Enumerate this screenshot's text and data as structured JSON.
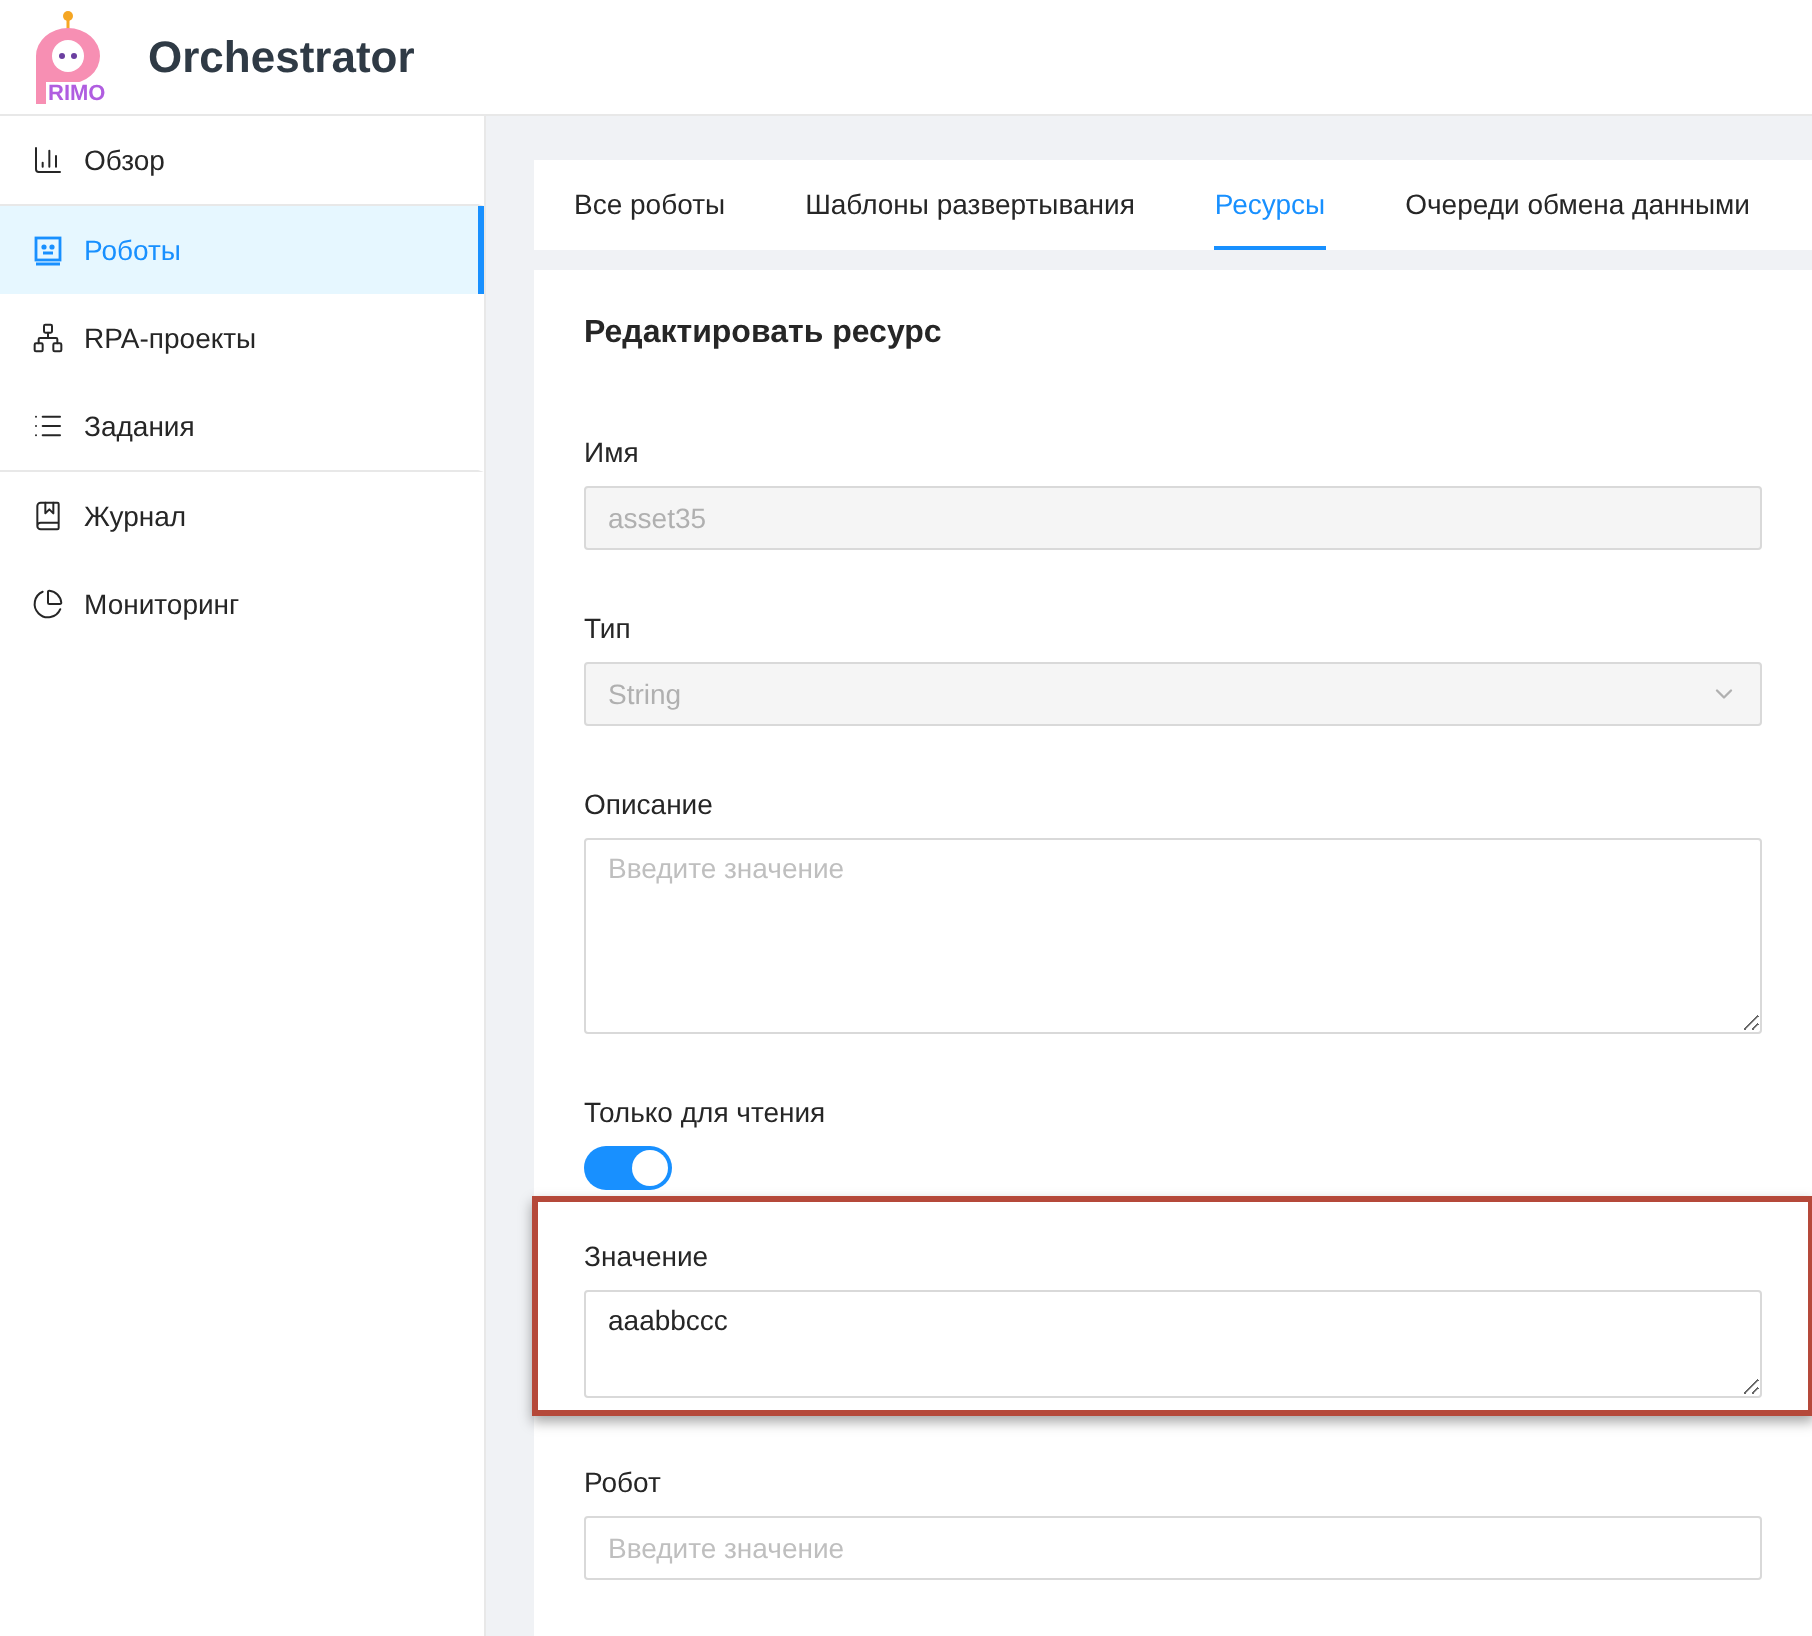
{
  "header": {
    "logo_text": "RIMO",
    "title": "Orchestrator"
  },
  "sidebar": {
    "items": [
      {
        "label": "Обзор",
        "selected": false,
        "divider_after": true
      },
      {
        "label": "Роботы",
        "selected": true,
        "divider_after": false
      },
      {
        "label": "RPA-проекты",
        "selected": false,
        "divider_after": false
      },
      {
        "label": "Задания",
        "selected": false,
        "divider_after": true
      },
      {
        "label": "Журнал",
        "selected": false,
        "divider_after": false
      },
      {
        "label": "Мониторинг",
        "selected": false,
        "divider_after": false
      }
    ]
  },
  "tabs": [
    {
      "label": "Все роботы",
      "selected": false
    },
    {
      "label": "Шаблоны развертывания",
      "selected": false
    },
    {
      "label": "Ресурсы",
      "selected": true
    },
    {
      "label": "Очереди обмена данными",
      "selected": false
    }
  ],
  "form": {
    "title": "Редактировать ресурс",
    "fields": [
      {
        "kind": "input",
        "label": "Имя",
        "value": "asset35",
        "disabled": true,
        "highlighted": false
      },
      {
        "kind": "select",
        "label": "Тип",
        "value": "String",
        "disabled": true,
        "highlighted": false
      },
      {
        "kind": "textarea",
        "label": "Описание",
        "placeholder": "Введите значение",
        "highlighted": false
      },
      {
        "kind": "switch",
        "label": "Только для чтения",
        "on": true,
        "highlighted": false
      },
      {
        "kind": "textarea_short",
        "label": "Значение",
        "value": "aaabbccc",
        "highlighted": true
      },
      {
        "kind": "input",
        "label": "Робот",
        "placeholder": "Введите значение",
        "highlighted": false
      }
    ]
  }
}
